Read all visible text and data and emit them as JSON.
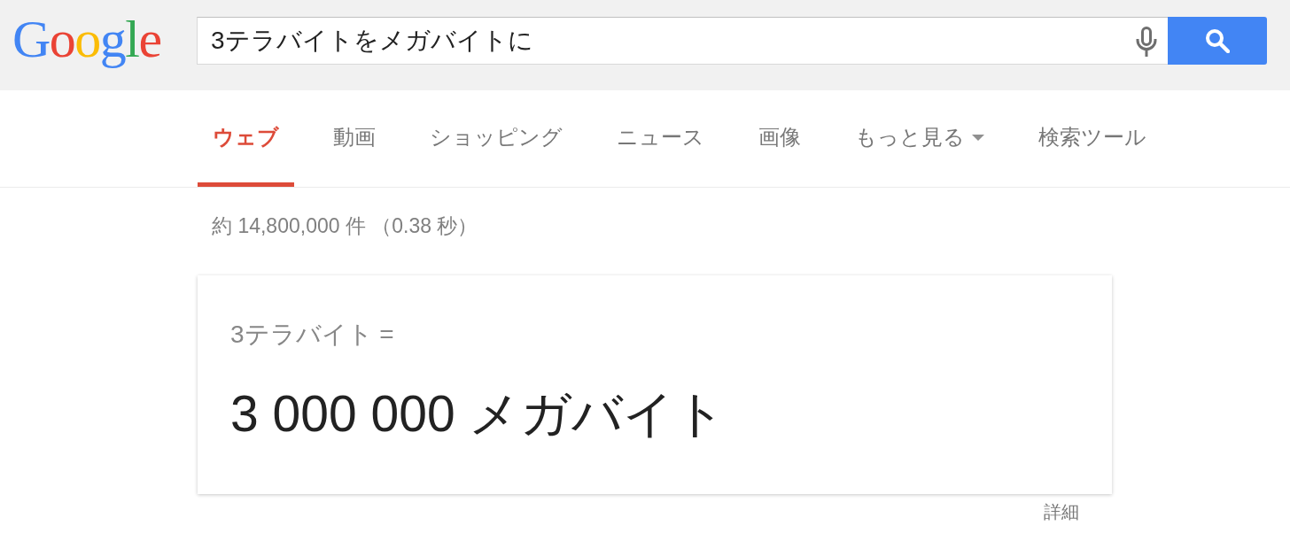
{
  "logo": {
    "text": "Google"
  },
  "search": {
    "value": "3テラバイトをメガバイトに"
  },
  "tabs": [
    {
      "label": "ウェブ",
      "selected": true,
      "kind": "link"
    },
    {
      "label": "動画",
      "selected": false,
      "kind": "link"
    },
    {
      "label": "ショッピング",
      "selected": false,
      "kind": "link"
    },
    {
      "label": "ニュース",
      "selected": false,
      "kind": "link"
    },
    {
      "label": "画像",
      "selected": false,
      "kind": "link"
    },
    {
      "label": "もっと見る",
      "selected": false,
      "kind": "dropdown"
    }
  ],
  "tools_button": {
    "label": "検索ツール"
  },
  "result_stats": "約 14,800,000 件 （0.38 秒）",
  "converter": {
    "from": "3テラバイト =",
    "result": "3 000 000 メガバイト"
  },
  "details_link": "詳細"
}
